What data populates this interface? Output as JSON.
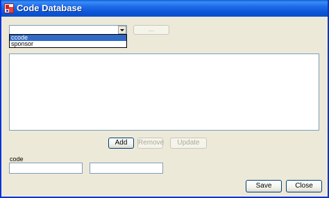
{
  "window": {
    "title": "Code Database",
    "app_icon": "app-logo-icon"
  },
  "type_selector": {
    "value": "",
    "options": [
      "ccode",
      "sponsor"
    ],
    "selected_option": "ccode",
    "expanded": true
  },
  "browse_button": {
    "label": "...",
    "enabled": false
  },
  "actions": {
    "add_label": "Add",
    "remove_label": "Remove",
    "update_label": "Update"
  },
  "code_field": {
    "label": "code",
    "value": "",
    "second_value": ""
  },
  "footer": {
    "save_label": "Save",
    "close_label": "Close"
  },
  "colors": {
    "titlebar": "#0a5fd8",
    "window_bg": "#ece9d8",
    "selection": "#316ac5"
  }
}
